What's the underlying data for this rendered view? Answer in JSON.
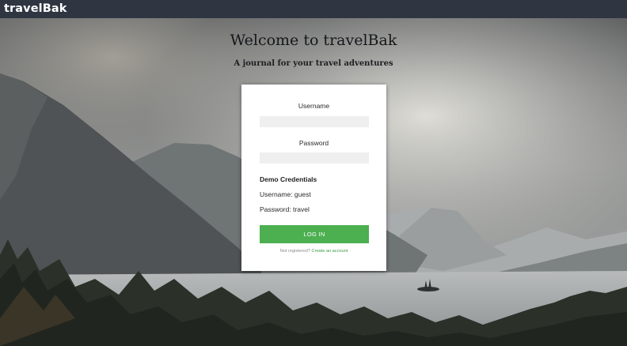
{
  "navbar": {
    "brand": "travelBak"
  },
  "hero": {
    "title": "Welcome to travelBak",
    "subtitle": "A journal for your travel adventures"
  },
  "login_form": {
    "username_label": "Username",
    "username_value": "",
    "password_label": "Password",
    "password_value": "",
    "demo_title": "Demo Credentials",
    "demo_username": "Username: guest",
    "demo_password": "Password: travel",
    "login_button": "LOG IN",
    "register_prompt": "Not registered?",
    "create_account_link": "Create an account"
  },
  "colors": {
    "navbar": "#2f3541",
    "button": "#4caf50",
    "link": "#3a9b3f"
  }
}
